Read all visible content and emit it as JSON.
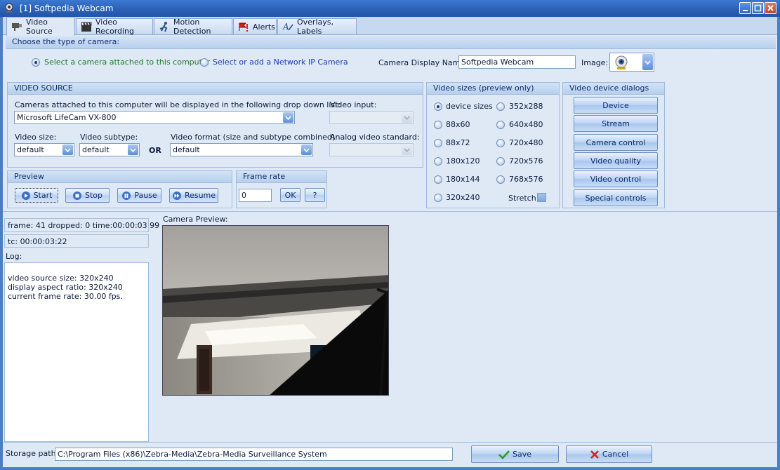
{
  "window": {
    "title": "[1] Softpedia Webcam"
  },
  "tabs": [
    {
      "label": "Video Source"
    },
    {
      "label": "Video Recording"
    },
    {
      "label": "Motion Detection"
    },
    {
      "label": "Alerts"
    },
    {
      "label": "Overlays, Labels"
    }
  ],
  "camera_type": {
    "header": "Choose the type of camera:",
    "option_local": "Select a camera attached to this computer",
    "option_network": "Select or add a Network IP Camera",
    "display_name_label": "Camera Display Name:",
    "display_name_value": "Softpedia Webcam",
    "image_label": "Image:"
  },
  "video_source": {
    "header": "VIDEO SOURCE",
    "cameras_label": "Cameras attached to this computer will be displayed in the following drop down list:",
    "camera_selected": "Microsoft LifeCam VX-800",
    "video_input_label": "Video input:",
    "video_size_label": "Video size:",
    "video_size_value": "default",
    "video_subtype_label": "Video subtype:",
    "video_subtype_value": "default",
    "or_label": "OR",
    "video_format_label": "Video format (size and subtype combined)",
    "video_format_value": "default",
    "analog_label": "Analog video standard:"
  },
  "preview": {
    "header": "Preview",
    "start": "Start",
    "stop": "Stop",
    "pause": "Pause",
    "resume": "Resume"
  },
  "frame_rate": {
    "header": "Frame rate",
    "value": "0",
    "ok": "OK",
    "help": "?"
  },
  "video_sizes": {
    "header": "Video sizes (preview only)",
    "options": [
      "device sizes",
      "352x288",
      "88x60",
      "640x480",
      "88x72",
      "720x480",
      "180x120",
      "720x576",
      "180x144",
      "768x576",
      "320x240"
    ],
    "stretch_label": "Stretch"
  },
  "device_dialogs": {
    "header": "Video device dialogs",
    "buttons": [
      "Device",
      "Stream",
      "Camera control",
      "Video quality",
      "Video control",
      "Special controls"
    ]
  },
  "status": {
    "frame_info": "frame: 41 dropped: 0 time:00:00:03 99",
    "timecode": "tc: 00:00:03:22",
    "log_label": "Log:",
    "log_lines": [
      "video source size: 320x240",
      "display aspect ratio: 320x240",
      "current frame rate: 30.00 fps."
    ],
    "camera_preview_label": "Camera Preview:"
  },
  "footer": {
    "storage_label": "Storage path:",
    "storage_value": "C:\\Program Files (x86)\\Zebra-Media\\Zebra-Media Surveillance System",
    "save": "Save",
    "cancel": "Cancel"
  },
  "colors": {
    "accent": "#2a5fb5",
    "panel_bg": "#dfe9f5",
    "radio_text_green": "#1a7a2a",
    "radio_text_blue": "#1a3bb0"
  }
}
